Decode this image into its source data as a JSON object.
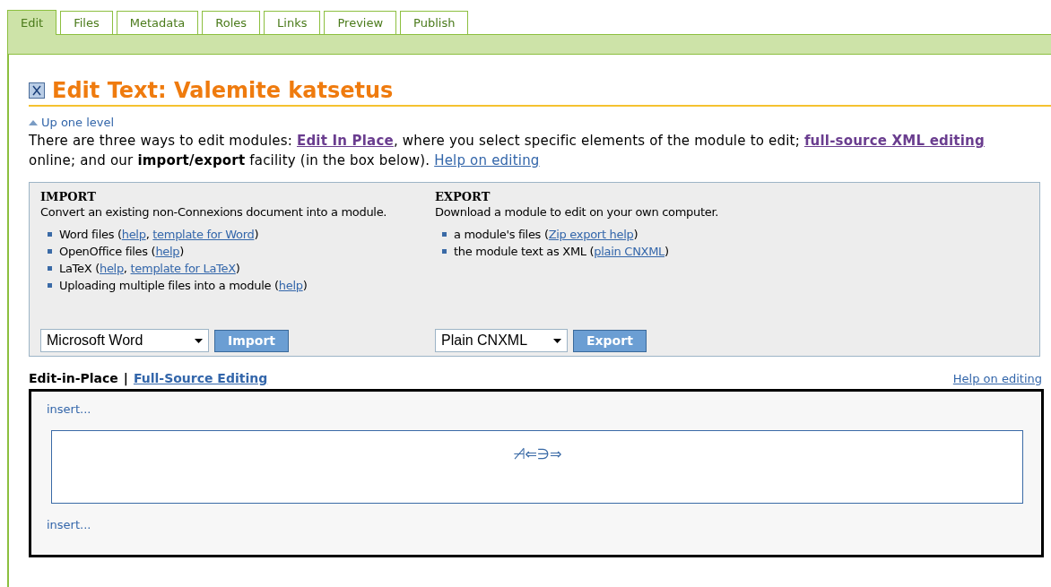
{
  "tabs": [
    {
      "label": "Edit",
      "selected": true
    },
    {
      "label": "Files",
      "selected": false
    },
    {
      "label": "Metadata",
      "selected": false
    },
    {
      "label": "Roles",
      "selected": false
    },
    {
      "label": "Links",
      "selected": false
    },
    {
      "label": "Preview",
      "selected": false
    },
    {
      "label": "Publish",
      "selected": false
    }
  ],
  "title": "Edit Text: Valemite katsetus",
  "up_link": "Up one level",
  "intro": [
    {
      "kind": "text",
      "text": "There are three ways to edit modules: "
    },
    {
      "kind": "visited",
      "text": "Edit In Place"
    },
    {
      "kind": "text",
      "text": ", where you select specific elements of the module to edit; "
    },
    {
      "kind": "visited",
      "text": "full-source XML editing"
    },
    {
      "kind": "text",
      "text": " online; and our "
    },
    {
      "kind": "bold",
      "text": "import/export"
    },
    {
      "kind": "text",
      "text": " facility (in the box below). "
    },
    {
      "kind": "link",
      "text": "Help on editing"
    }
  ],
  "import": {
    "heading": "IMPORT",
    "description": "Convert an existing non-Connexions document into a module.",
    "items": [
      [
        {
          "kind": "text",
          "text": "Word files ("
        },
        {
          "kind": "link",
          "text": "help"
        },
        {
          "kind": "text",
          "text": ", "
        },
        {
          "kind": "link",
          "text": "template for Word"
        },
        {
          "kind": "text",
          "text": ")"
        }
      ],
      [
        {
          "kind": "text",
          "text": "OpenOffice files ("
        },
        {
          "kind": "link",
          "text": "help"
        },
        {
          "kind": "text",
          "text": ")"
        }
      ],
      [
        {
          "kind": "text",
          "text": "LaTeX ("
        },
        {
          "kind": "link",
          "text": "help"
        },
        {
          "kind": "text",
          "text": ", "
        },
        {
          "kind": "link",
          "text": "template for LaTeX"
        },
        {
          "kind": "text",
          "text": ")"
        }
      ],
      [
        {
          "kind": "text",
          "text": "Uploading multiple files into a module ("
        },
        {
          "kind": "link",
          "text": "help"
        },
        {
          "kind": "text",
          "text": ")"
        }
      ]
    ],
    "select": "Microsoft Word",
    "button": "Import"
  },
  "export": {
    "heading": "EXPORT",
    "description": "Download a module to edit on your own computer.",
    "items": [
      [
        {
          "kind": "text",
          "text": "a module's files ("
        },
        {
          "kind": "link",
          "text": "Zip export help"
        },
        {
          "kind": "text",
          "text": ")"
        }
      ],
      [
        {
          "kind": "text",
          "text": "the module text as XML ("
        },
        {
          "kind": "link",
          "text": "plain CNXML"
        },
        {
          "kind": "text",
          "text": ")"
        }
      ]
    ],
    "select": "Plain CNXML",
    "button": "Export"
  },
  "mode_tabs": [
    {
      "label": "Edit-in-Place",
      "selected": true
    },
    {
      "label": "Full-Source Editing",
      "selected": false
    }
  ],
  "mode_separator": "|",
  "help_link": "Help on editing",
  "editor": {
    "insert_top": "insert...",
    "formula": "⊣̸⇐∋⇒",
    "insert_bottom": "insert..."
  }
}
